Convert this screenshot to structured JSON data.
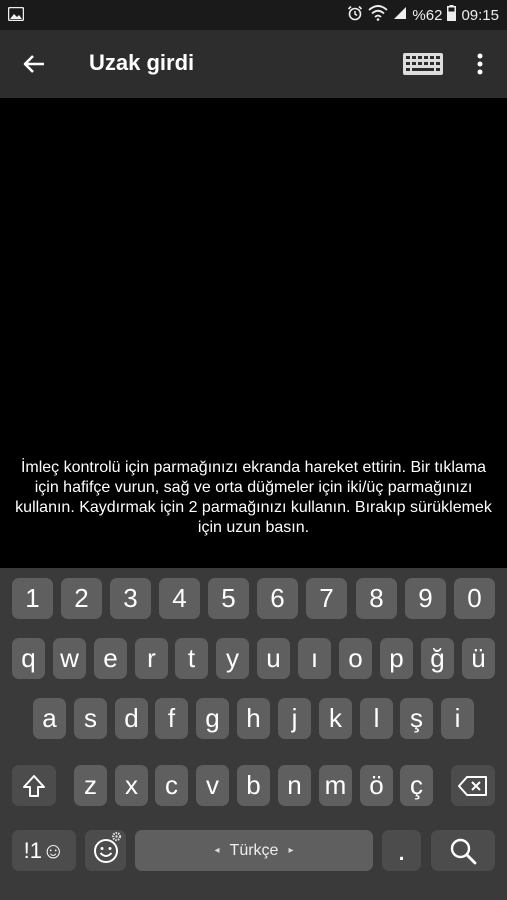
{
  "status_bar": {
    "battery_percent": "%62",
    "time": "09:15",
    "icons": [
      "image-icon",
      "alarm-icon",
      "wifi-icon",
      "signal-icon",
      "battery-icon"
    ]
  },
  "app_bar": {
    "title": "Uzak girdi",
    "icons": [
      "back-arrow-icon",
      "keyboard-icon",
      "more-vert-icon"
    ]
  },
  "touchpad": {
    "hint": "İmleç kontrolü için parmağınızı ekranda hareket ettirin. Bir tıklama için hafifçe vurun, sağ ve orta düğmeler için iki/üç parmağınızı kullanın. Kaydırmak için 2 parmağınızı kullanın. Bırakıp sürüklemek için uzun basın."
  },
  "keyboard": {
    "row_numbers": [
      "1",
      "2",
      "3",
      "4",
      "5",
      "6",
      "7",
      "8",
      "9",
      "0"
    ],
    "row1": [
      "q",
      "w",
      "e",
      "r",
      "t",
      "y",
      "u",
      "ı",
      "o",
      "p",
      "ğ",
      "ü"
    ],
    "row2": [
      "a",
      "s",
      "d",
      "f",
      "g",
      "h",
      "j",
      "k",
      "l",
      "ş",
      "i"
    ],
    "row3": [
      "z",
      "x",
      "c",
      "v",
      "b",
      "n",
      "m",
      "ö",
      "ç"
    ],
    "symbols_label": "!1☺",
    "space_label": "Türkçe",
    "space_arrow_left": "◂",
    "space_arrow_right": "▸",
    "period": ".",
    "special_icons": [
      "shift-icon",
      "backspace-icon",
      "emoji-icon",
      "settings-icon",
      "search-icon"
    ]
  }
}
